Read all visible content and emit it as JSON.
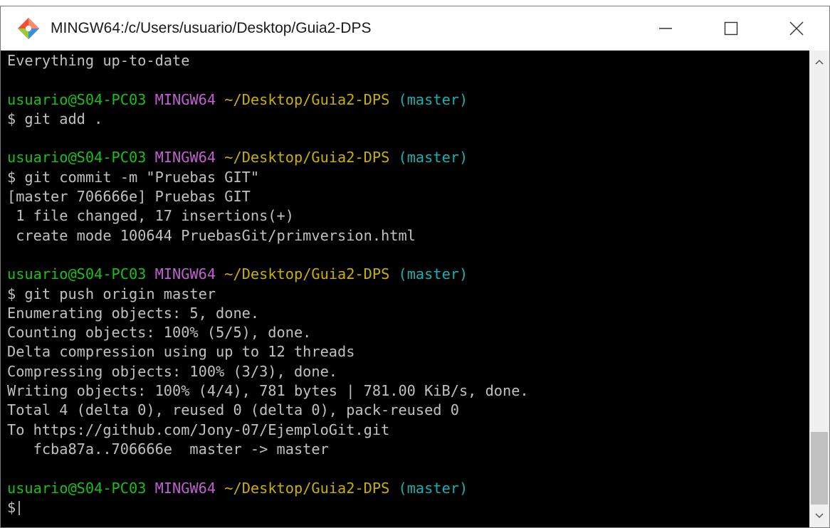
{
  "window": {
    "title": "MINGW64:/c/Users/usuario/Desktop/Guia2-DPS",
    "minimize_icon": "minimize-icon",
    "maximize_icon": "maximize-icon",
    "close_icon": "close-icon"
  },
  "prompt": {
    "user": "usuario@S04-PC03",
    "env": "MINGW64",
    "path": "~/Desktop/Guia2-DPS",
    "branch": "(master)"
  },
  "terminal": {
    "l01": "Everything up-to-date",
    "l02": "",
    "l04": "$ git add .",
    "l05": "",
    "l07": "$ git commit -m \"Pruebas GIT\"",
    "l08": "[master 706666e] Pruebas GIT",
    "l09": " 1 file changed, 17 insertions(+)",
    "l10": " create mode 100644 PruebasGit/primversion.html",
    "l11": "",
    "l13": "$ git push origin master",
    "l14": "Enumerating objects: 5, done.",
    "l15": "Counting objects: 100% (5/5), done.",
    "l16": "Delta compression using up to 12 threads",
    "l17": "Compressing objects: 100% (3/3), done.",
    "l18": "Writing objects: 100% (4/4), 781 bytes | 781.00 KiB/s, done.",
    "l19": "Total 4 (delta 0), reused 0 (delta 0), pack-reused 0",
    "l20": "To https://github.com/Jony-07/EjemploGit.git",
    "l21": "   fcba87a..706666e  master -> master",
    "l22": "",
    "l24": "$"
  },
  "colors": {
    "user": "#18c018",
    "env": "#c060d0",
    "path": "#c8b000",
    "branch": "#18b0b0"
  }
}
